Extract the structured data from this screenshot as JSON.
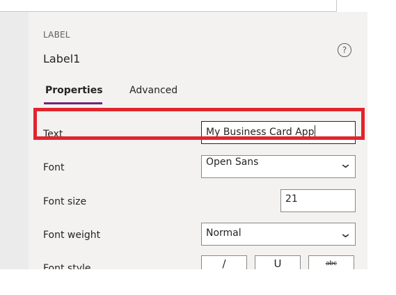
{
  "panel": {
    "control_type": "LABEL",
    "control_name": "Label1",
    "help_glyph": "?"
  },
  "tabs": {
    "properties": "Properties",
    "advanced": "Advanced"
  },
  "properties": {
    "text_label": "Text",
    "text_value": "My Business Card App",
    "font_label": "Font",
    "font_value": "Open Sans",
    "font_size_label": "Font size",
    "font_size_value": "21",
    "font_weight_label": "Font weight",
    "font_weight_value": "Normal",
    "font_style_label": "Font style",
    "style_buttons": [
      "/",
      "U",
      "abc"
    ]
  },
  "icons": {
    "help": "help-circle-icon",
    "dropdown": "chevron-down-icon"
  },
  "colors": {
    "panel_bg": "#f3f2f1",
    "accent": "#742774",
    "highlight": "#e1252d"
  }
}
